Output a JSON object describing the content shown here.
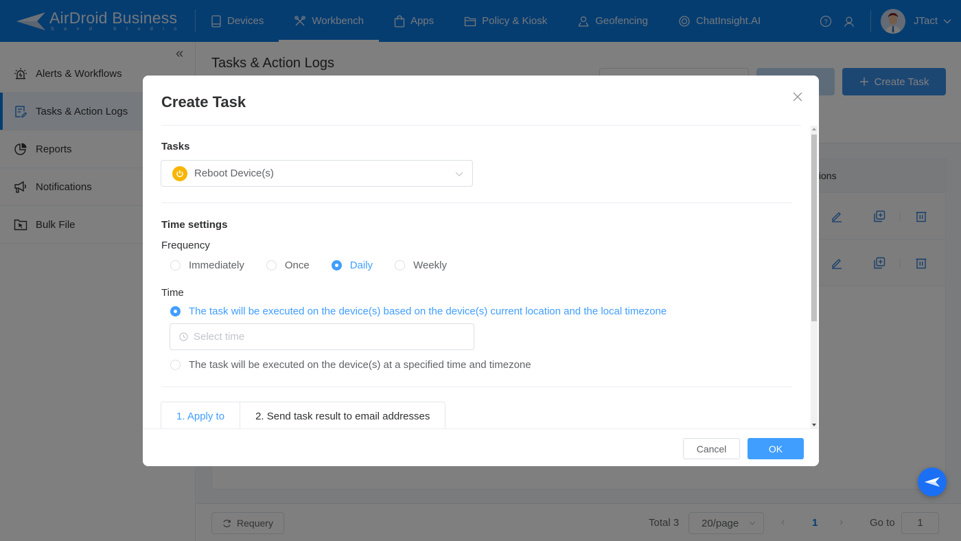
{
  "topbar": {
    "logo": {
      "name": "AirDroid Business",
      "sub": "Sand Studio"
    },
    "nav": [
      {
        "label": "Devices",
        "icon": "tablet-icon",
        "active": false
      },
      {
        "label": "Workbench",
        "icon": "tools-icon",
        "active": true
      },
      {
        "label": "Apps",
        "icon": "shopping-bag-icon",
        "active": false
      },
      {
        "label": "Policy & Kiosk",
        "icon": "folder-icon",
        "active": false
      },
      {
        "label": "Geofencing",
        "icon": "location-pin-icon",
        "active": false
      },
      {
        "label": "ChatInsight.AI",
        "icon": "chat-ai-icon",
        "active": false
      }
    ],
    "help_icon": "help-circle-icon",
    "support_icon": "headset-agent-icon",
    "user": {
      "name": "JTact"
    }
  },
  "sidebar": {
    "collapse_label": "«",
    "items": [
      {
        "label": "Alerts & Workflows",
        "icon": "alarm-icon",
        "active": false
      },
      {
        "label": "Tasks & Action Logs",
        "icon": "task-list-icon",
        "active": true
      },
      {
        "label": "Reports",
        "icon": "pie-chart-icon",
        "active": false
      },
      {
        "label": "Notifications",
        "icon": "megaphone-icon",
        "active": false
      },
      {
        "label": "Bulk File",
        "icon": "folder-cursor-icon",
        "active": false
      }
    ]
  },
  "main": {
    "page_title": "Tasks & Action Logs",
    "create_task_label": "Create Task",
    "table": {
      "actions_header": "tions",
      "rows": 2
    },
    "footer": {
      "requery_label": "Requery",
      "total": "Total 3",
      "page_size": "20/page",
      "prev": "‹",
      "current_page": "1",
      "next": "›",
      "goto_label": "Go to",
      "goto_value": "1"
    }
  },
  "modal": {
    "title": "Create Task",
    "tasks_label": "Tasks",
    "task_value": "Reboot Device(s)",
    "time_settings_label": "Time settings",
    "frequency_label": "Frequency",
    "frequency_options": [
      {
        "label": "Immediately",
        "checked": false
      },
      {
        "label": "Once",
        "checked": false
      },
      {
        "label": "Daily",
        "checked": true
      },
      {
        "label": "Weekly",
        "checked": false
      }
    ],
    "time_label": "Time",
    "time_options": [
      {
        "label": "The task will be executed on the device(s) based on the device(s) current location and the local timezone",
        "checked": true
      },
      {
        "label": "The task will be executed on the device(s) at a specified time and timezone",
        "checked": false
      }
    ],
    "time_placeholder": "Select time",
    "tabs": [
      {
        "label": "1. Apply to",
        "active": true
      },
      {
        "label": "2. Send task result to email addresses",
        "active": false
      }
    ],
    "cancel_label": "Cancel",
    "ok_label": "OK"
  }
}
